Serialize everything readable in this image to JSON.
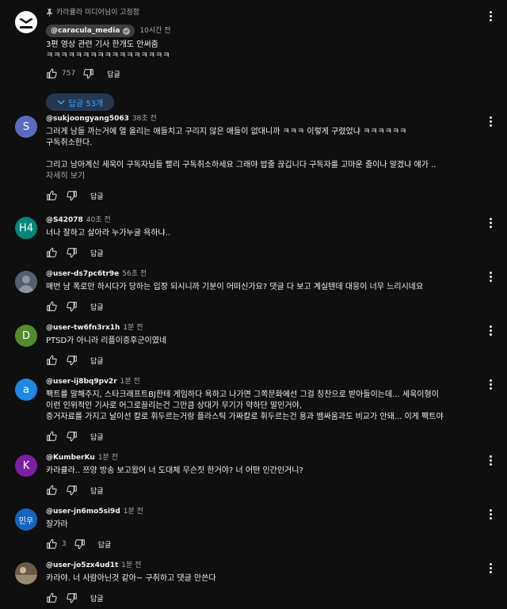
{
  "pinned": {
    "pinned_label": "카라큘라 미디어님이 고정함",
    "avatar_label": "CARACULA",
    "handle": "@caracula_media",
    "time": "10시간 전",
    "text": "3편 영상 관련 기사 한개도 안써줌\nㅋㅋㅋㅋㅋㅋㅋㅋㅋㅋㅋㅋㅋㅋㅋㅋㅋ",
    "likes": "757",
    "reply_label": "답글",
    "replies_label": "답글 53개"
  },
  "comments": [
    {
      "avatar_letter": "S",
      "avatar_color": "#5c6bc0",
      "handle": "@sukjoongyang5063",
      "time": "38초 전",
      "text": "그러게 남들 까는거에 열 올리는 애들치고 구리지 않은 애들이 없대니까 ㅋㅋㅋ 이렇게 구렸었냐 ㅋㅋㅋㅋㅋㅋ\n구독취소한다.\n\n그리고 남아계신 세욱이 구독자님들 빨리 구독취소하세요 그래야 밥줄 끊깁니다 구독자를 고마운 줄이나 알겠냐 얘가 ..",
      "more": "자세히 보기",
      "likes": "",
      "reply_label": "답글"
    },
    {
      "avatar_letter": "H4",
      "avatar_color": "#00897b",
      "handle": "@S42078",
      "time": "40초 전",
      "text": "너나 잘하고 살아라 누가누굴 욕하냐..",
      "likes": "",
      "reply_label": "답글"
    },
    {
      "avatar_letter": "",
      "avatar_color": "#3a4a5a",
      "handle": "@user-ds7pc6tr9e",
      "time": "56초 전",
      "text": "매번 남 폭로만 하시다가 당하는 입장 되시니까 기분이 어떠신가요? 댓글 다 보고 계실텐데 대응이 너무 느리시네요",
      "likes": "",
      "reply_label": "답글"
    },
    {
      "avatar_letter": "D",
      "avatar_color": "#558b2f",
      "handle": "@user-tw6fn3rx1h",
      "time": "1분 전",
      "text": "PTSD가 아니라 리플이증후군이였네",
      "likes": "",
      "reply_label": "답글"
    },
    {
      "avatar_letter": "a",
      "avatar_color": "#1e88e5",
      "handle": "@user-ij8bq9pv2r",
      "time": "1분 전",
      "text": "팩트를 말해주지, 스타크래프트BJ한테 게임하다 욕하고 나가면 그쪽문화에선 그걸 칭찬으로 받아들이는데... 세욱이형이\n이런 인위적인 기사로 어그로끌리는건 그만큼 상대가 무기가 약하단 말인거야,\n증거자료를 가지고 날이선 칼로 휘두르는거랑 플라스틱 가짜칼로 휘두르는건 용과 뱀싸움과도 비교가 안돼... 이게 팩트야",
      "likes": "",
      "reply_label": "답글"
    },
    {
      "avatar_letter": "K",
      "avatar_color": "#7b1fa2",
      "handle": "@KumberKu",
      "time": "1분 전",
      "text": "카라큘라.. 쯔양 방송 보고왔어 너 도대체 무슨짓 한거야? 너 어떤 인간인거니?",
      "likes": "",
      "reply_label": "답글"
    },
    {
      "avatar_letter": "민우",
      "avatar_color": "#1565c0",
      "handle": "@user-jn6mo5si9d",
      "time": "1분 전",
      "text": "잘가라",
      "likes": "3",
      "reply_label": "답글"
    },
    {
      "avatar_letter": "",
      "avatar_color": "#5d4e3c",
      "handle": "@user-jo5zx4ud1t",
      "time": "1분 전",
      "text": "카라야. 너 사람아닌것 같아~ 구취하고 댓글 안쓴다",
      "likes": "",
      "reply_label": "답글"
    }
  ]
}
